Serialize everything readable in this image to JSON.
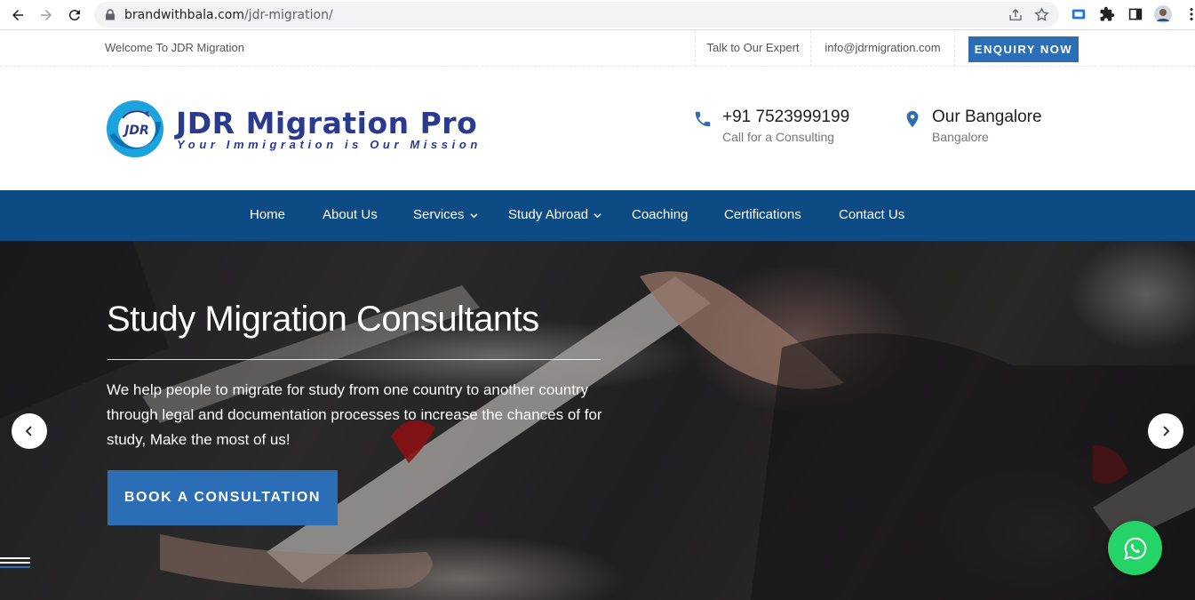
{
  "browser": {
    "url_domain": "brandwithbala.com",
    "url_path": "/jdr-migration/"
  },
  "topbar": {
    "welcome": "Welcome To JDR Migration",
    "expert": "Talk to Our Expert",
    "email": "info@jdrmigration.com",
    "enquiry_label": "ENQUIRY NOW"
  },
  "header": {
    "logo_text": "JDR",
    "brand_name": "JDR Migration Pro",
    "tagline": "Your Immigration is Our Mission",
    "phone": "+91 7523999199",
    "phone_sub": "Call for a Consulting",
    "location": "Our Bangalore",
    "location_sub": "Bangalore"
  },
  "nav": {
    "items": [
      {
        "label": "Home"
      },
      {
        "label": "About Us"
      },
      {
        "label": "Services"
      },
      {
        "label": "Study Abroad"
      },
      {
        "label": "Coaching"
      },
      {
        "label": "Certifications"
      },
      {
        "label": "Contact Us"
      }
    ]
  },
  "hero": {
    "title": "Study Migration Consultants",
    "description": "We help people to migrate for study from one country to another country through legal and documentation processes to increase the chances of for study, Make the most of us!",
    "button_label": "BOOK A CONSULTATION"
  },
  "colors": {
    "nav_bg": "#0d4b85",
    "accent": "#2c6eb5",
    "brand": "#2a3a8f",
    "whatsapp": "#25d366"
  }
}
